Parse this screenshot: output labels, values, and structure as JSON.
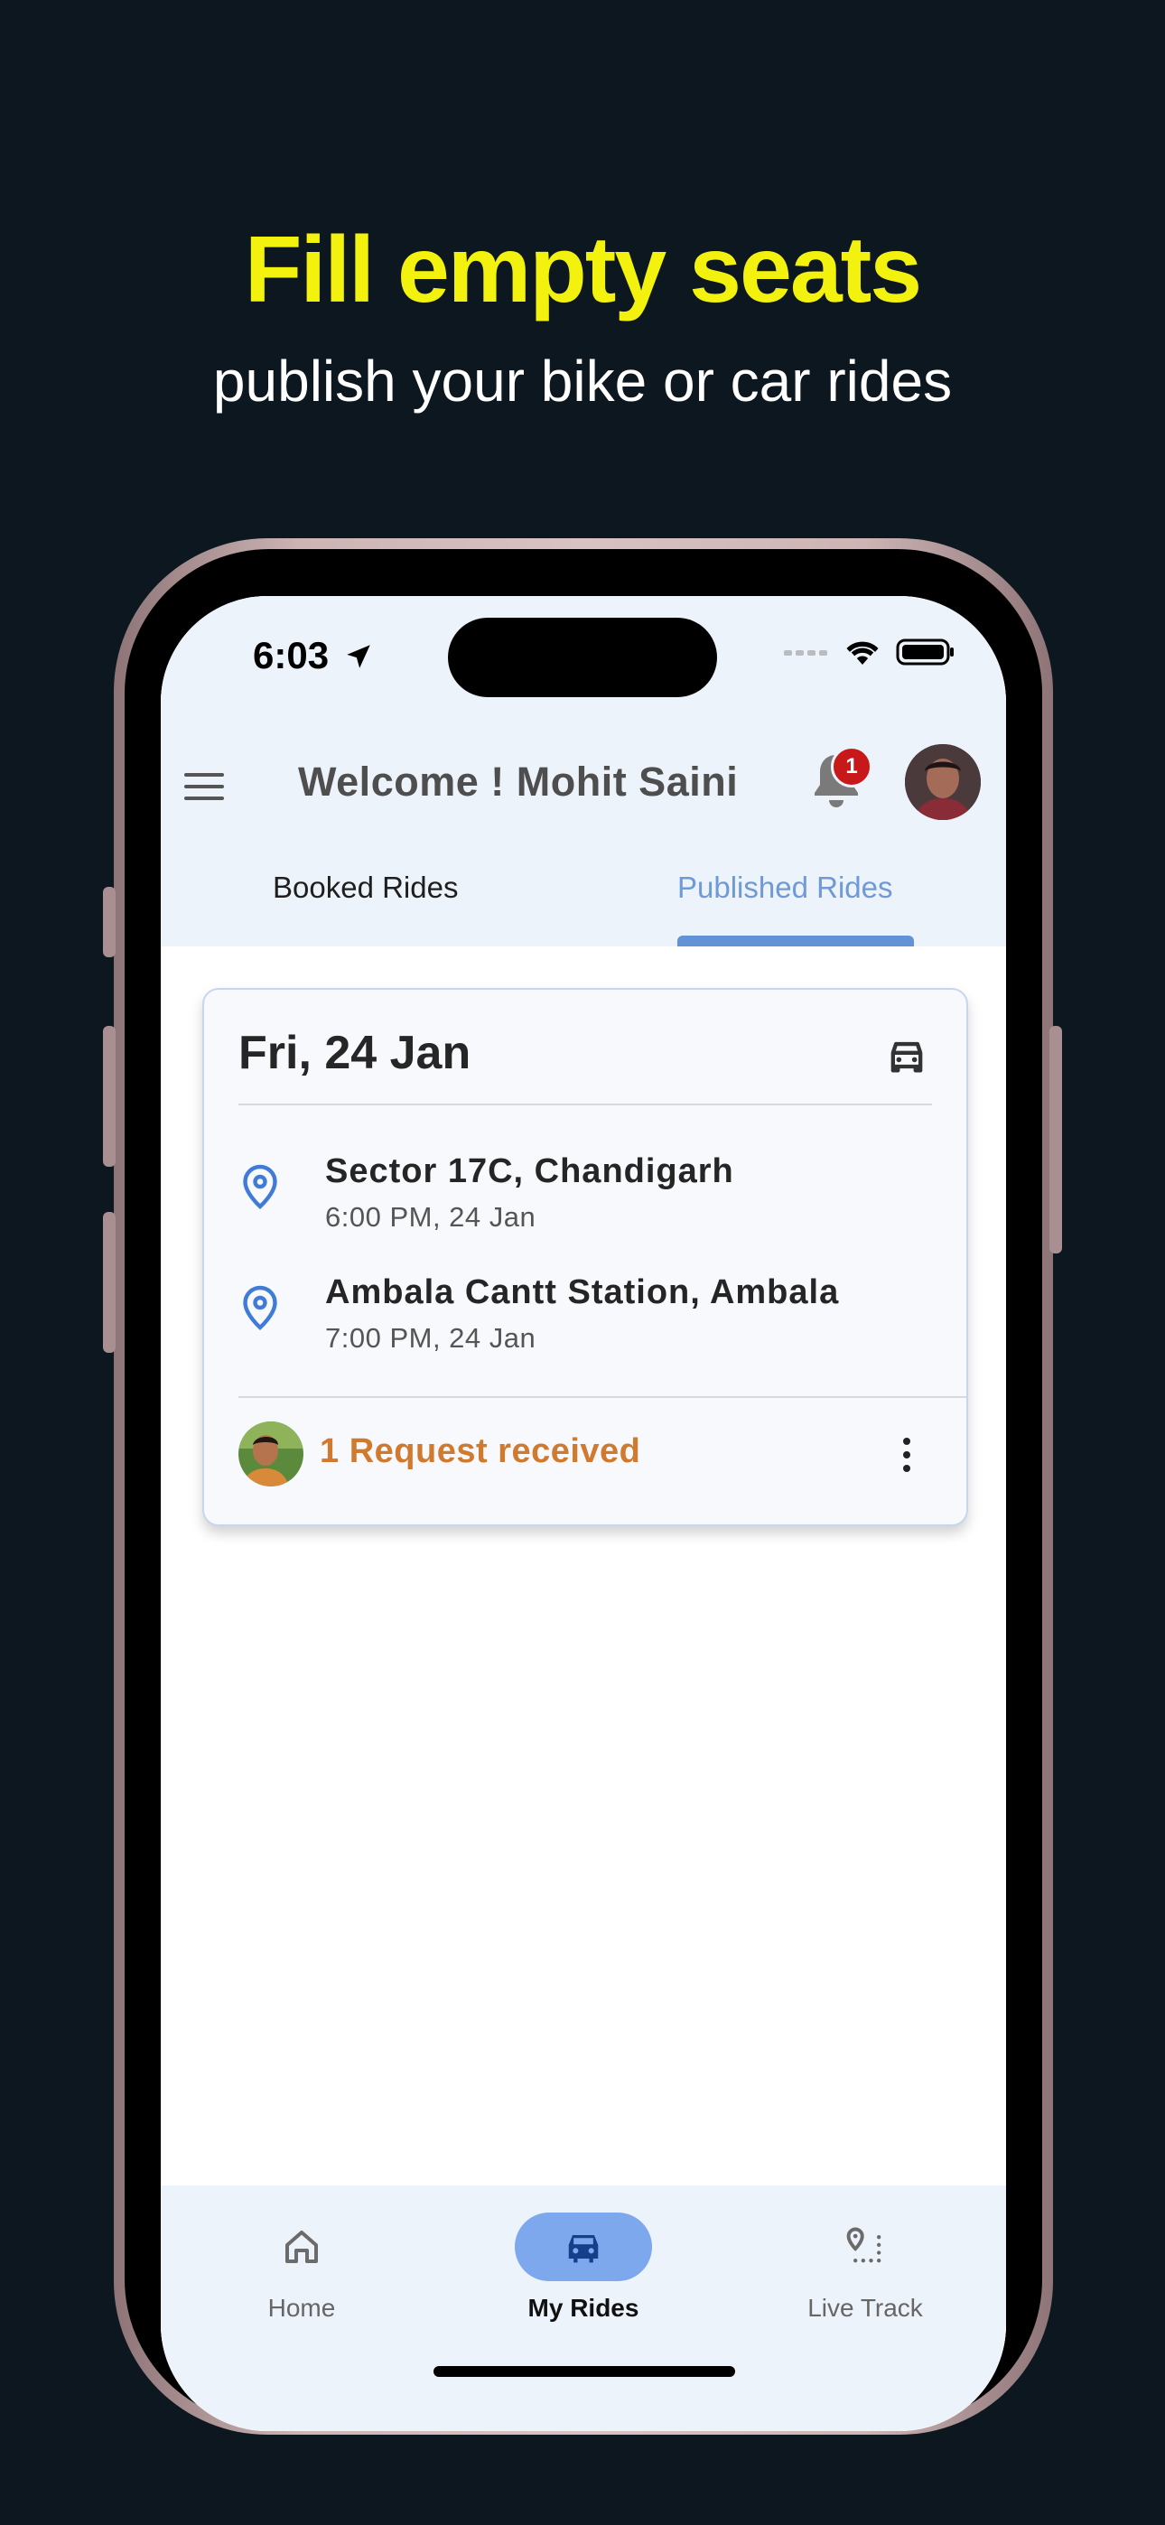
{
  "promo": {
    "headline": "Fill empty seats",
    "subline": "publish your bike or car rides"
  },
  "status_bar": {
    "time": "6:03"
  },
  "header": {
    "welcome": "Welcome ! Mohit Saini",
    "notification_count": "1"
  },
  "tabs": [
    {
      "label": "Booked Rides",
      "active": false
    },
    {
      "label": "Published Rides",
      "active": true
    }
  ],
  "ride_card": {
    "date": "Fri, 24 Jan",
    "vehicle_icon": "car-icon",
    "stops": [
      {
        "name": "Sector 17C, Chandigarh",
        "time": "6:00 PM, 24 Jan"
      },
      {
        "name": "Ambala Cantt Station, Ambala",
        "time": "7:00 PM, 24 Jan"
      }
    ],
    "request_text": "1 Request received"
  },
  "bottom_nav": [
    {
      "label": "Home",
      "icon": "home-icon",
      "active": false
    },
    {
      "label": "My Rides",
      "icon": "car-icon",
      "active": true
    },
    {
      "label": "Live Track",
      "icon": "route-icon",
      "active": false
    }
  ],
  "colors": {
    "background": "#0c1720",
    "headline": "#f3f20f",
    "accent": "#6393d6",
    "request": "#d07a2f",
    "badge": "#c8191a"
  }
}
